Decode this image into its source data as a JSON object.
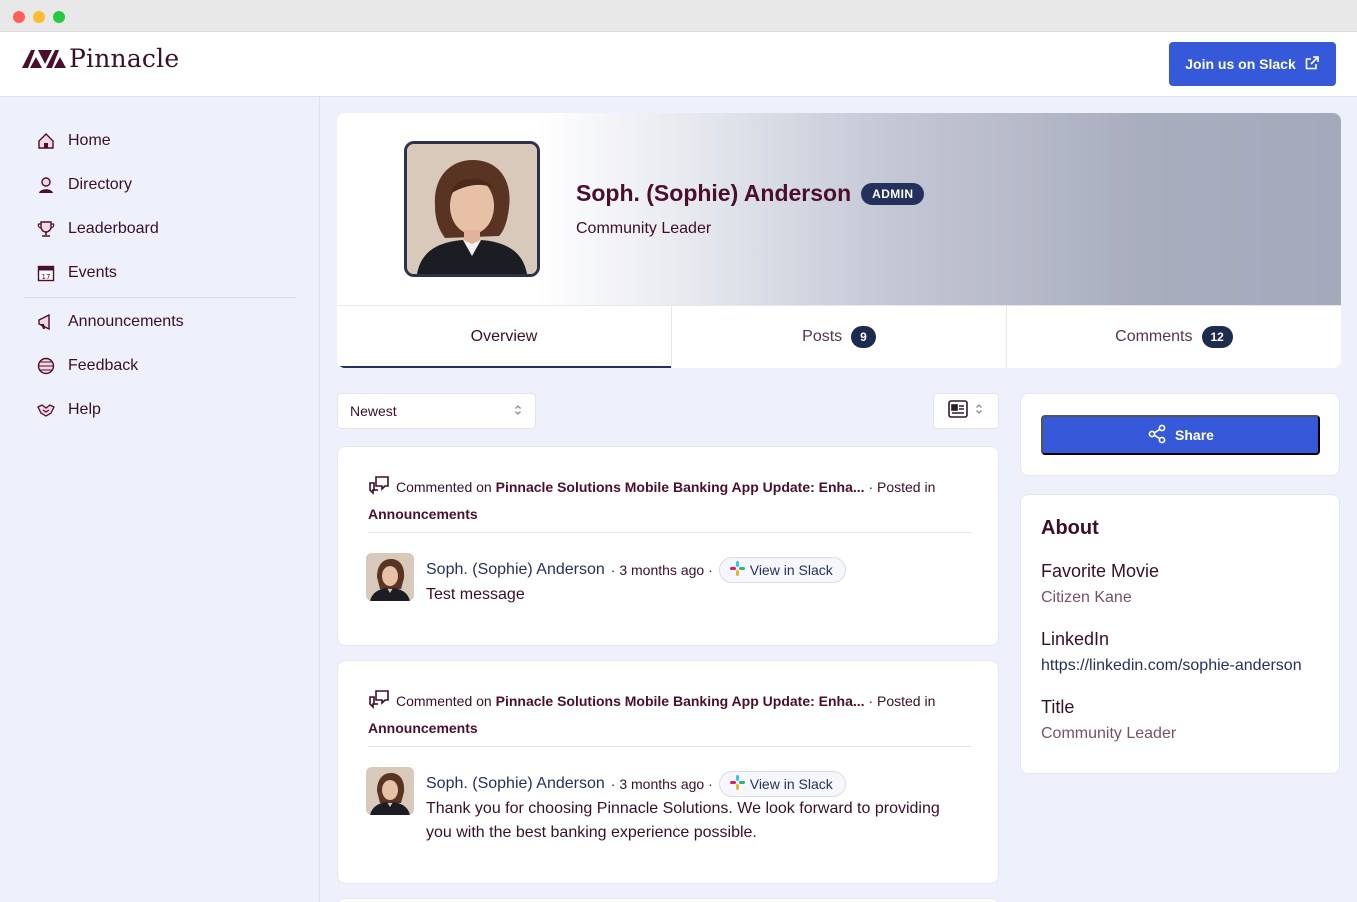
{
  "brand": {
    "name": "Pinnacle",
    "join_label": "Join us on Slack",
    "accent": "#3559d8"
  },
  "sidebar": {
    "items": [
      {
        "label": "Home",
        "icon": "home-icon"
      },
      {
        "label": "Directory",
        "icon": "directory-icon"
      },
      {
        "label": "Leaderboard",
        "icon": "trophy-icon"
      },
      {
        "label": "Events",
        "icon": "calendar-icon"
      },
      {
        "label": "Announcements",
        "icon": "megaphone-icon"
      },
      {
        "label": "Feedback",
        "icon": "globe-icon"
      },
      {
        "label": "Help",
        "icon": "handshake-icon"
      }
    ]
  },
  "profile": {
    "name": "Soph. (Sophie) Anderson",
    "badge": "ADMIN",
    "role": "Community Leader",
    "tabs": [
      {
        "label": "Overview"
      },
      {
        "label": "Posts",
        "count": "9"
      },
      {
        "label": "Comments",
        "count": "12"
      }
    ]
  },
  "feed": {
    "sort": "Newest",
    "items": [
      {
        "action": "Commented on",
        "post_title": "Pinnacle Solutions Mobile Banking App Update: Enha...",
        "posted_in_label": "· Posted in",
        "channel": "Announcements",
        "author": "Soph. (Sophie) Anderson",
        "time": "· 3 months ago ·",
        "slack_label": "View in Slack",
        "text": "Test message"
      },
      {
        "action": "Commented on",
        "post_title": "Pinnacle Solutions Mobile Banking App Update: Enha...",
        "posted_in_label": "· Posted in",
        "channel": "Announcements",
        "author": "Soph. (Sophie) Anderson",
        "time": "· 3 months ago ·",
        "slack_label": "View in Slack",
        "text": "Thank you for choosing Pinnacle Solutions. We look forward to providing you with the best banking experience possible."
      }
    ]
  },
  "share": {
    "label": "Share"
  },
  "about": {
    "title": "About",
    "fields": [
      {
        "label": "Favorite Movie",
        "value": "Citizen Kane"
      },
      {
        "label": "LinkedIn",
        "value": "https://linkedin.com/sophie-anderson"
      },
      {
        "label": "Title",
        "value": "Community Leader"
      }
    ]
  }
}
